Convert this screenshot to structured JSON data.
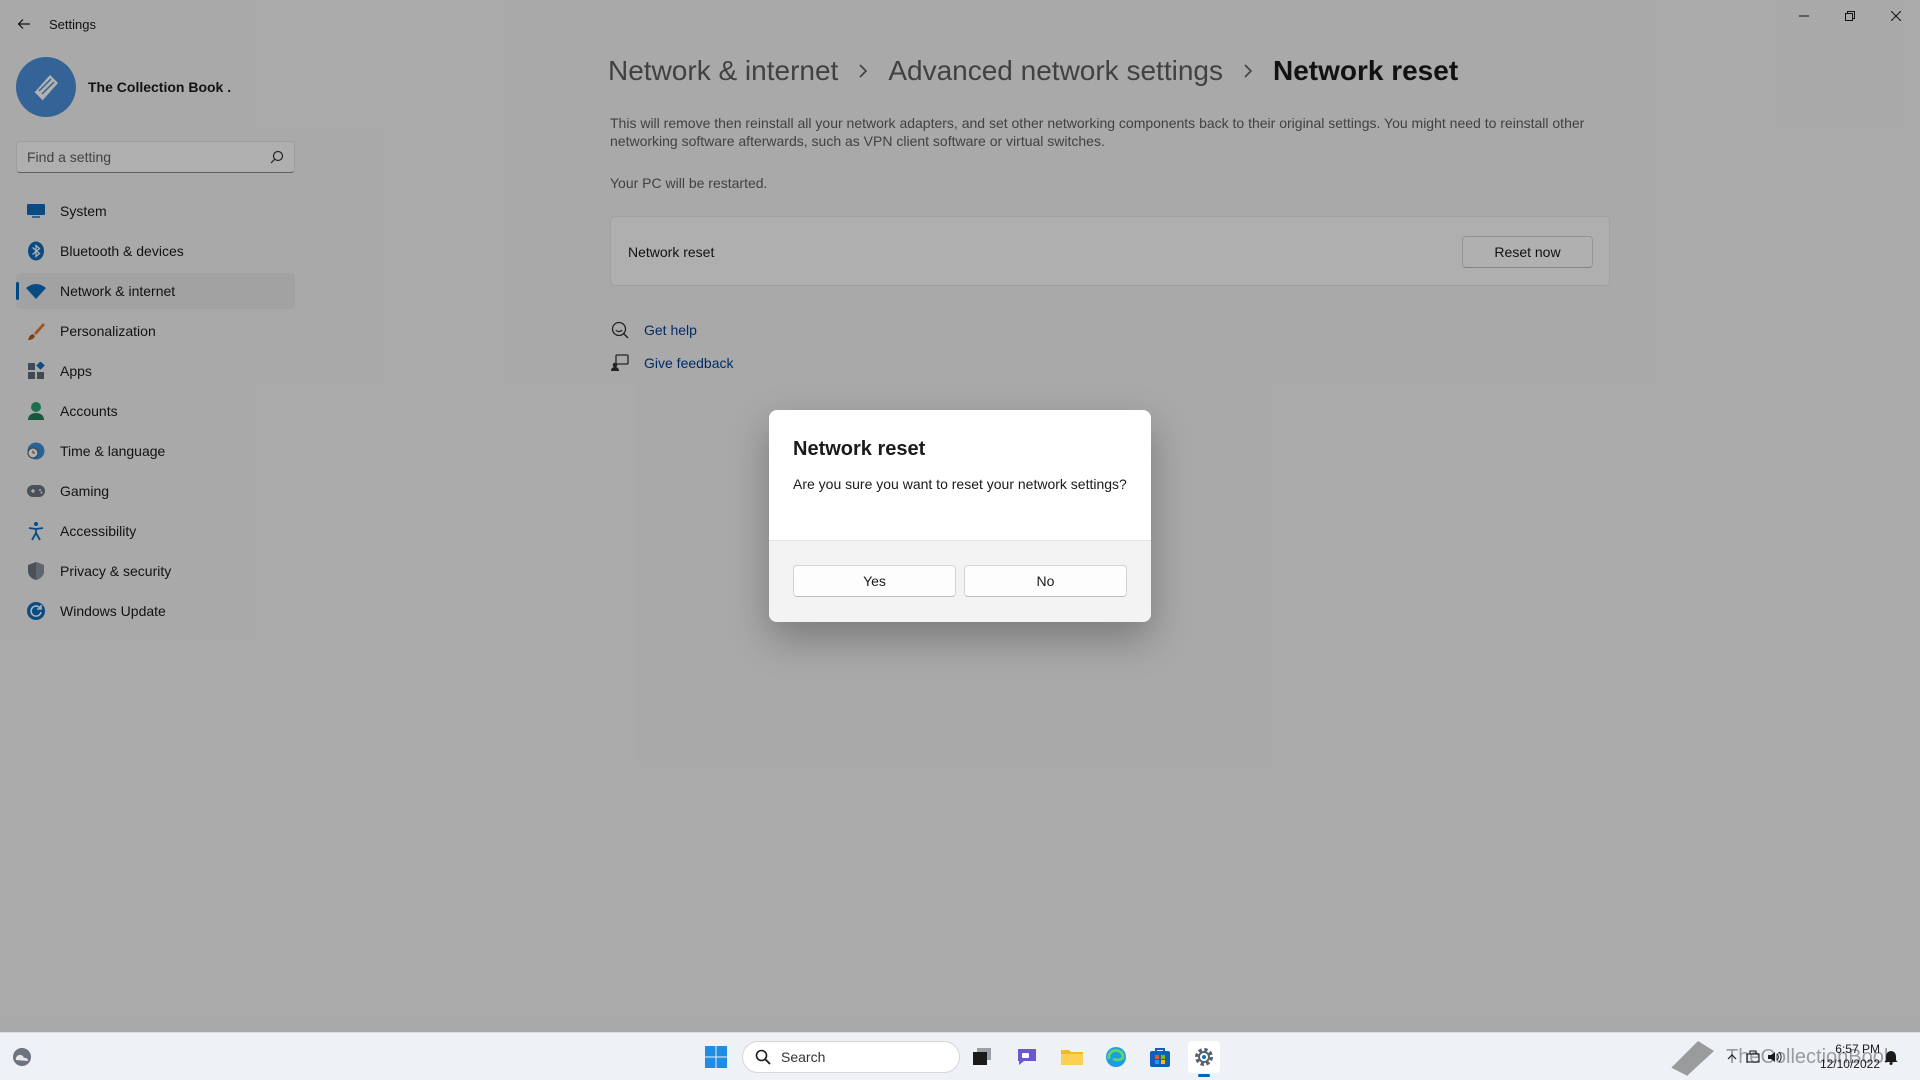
{
  "window": {
    "app_title": "Settings"
  },
  "profile": {
    "name": "The Collection Book ."
  },
  "search": {
    "placeholder": "Find a setting"
  },
  "sidebar": {
    "items": [
      {
        "label": "System",
        "icon": "monitor-icon"
      },
      {
        "label": "Bluetooth & devices",
        "icon": "bluetooth-icon"
      },
      {
        "label": "Network & internet",
        "icon": "wifi-icon",
        "active": true
      },
      {
        "label": "Personalization",
        "icon": "brush-icon"
      },
      {
        "label": "Apps",
        "icon": "apps-icon"
      },
      {
        "label": "Accounts",
        "icon": "person-icon"
      },
      {
        "label": "Time & language",
        "icon": "globe-clock-icon"
      },
      {
        "label": "Gaming",
        "icon": "gamepad-icon"
      },
      {
        "label": "Accessibility",
        "icon": "accessibility-icon"
      },
      {
        "label": "Privacy & security",
        "icon": "shield-icon"
      },
      {
        "label": "Windows Update",
        "icon": "update-icon"
      }
    ]
  },
  "breadcrumb": {
    "level1": "Network & internet",
    "level2": "Advanced network settings",
    "current": "Network reset"
  },
  "content": {
    "description": "This will remove then reinstall all your network adapters, and set other networking components back to their original settings. You might need to reinstall other networking software afterwards, such as VPN client software or virtual switches.",
    "restart_note": "Your PC will be restarted.",
    "card_label": "Network reset",
    "reset_button": "Reset now",
    "get_help": "Get help",
    "give_feedback": "Give feedback"
  },
  "dialog": {
    "title": "Network reset",
    "message": "Are you sure you want to reset your network settings?",
    "yes": "Yes",
    "no": "No"
  },
  "taskbar": {
    "search_label": "Search",
    "time": "6:57 PM",
    "date": "12/10/2022",
    "watermark": "TheCollectionBook"
  },
  "colors": {
    "accent": "#0067c0",
    "link": "#003e92"
  }
}
